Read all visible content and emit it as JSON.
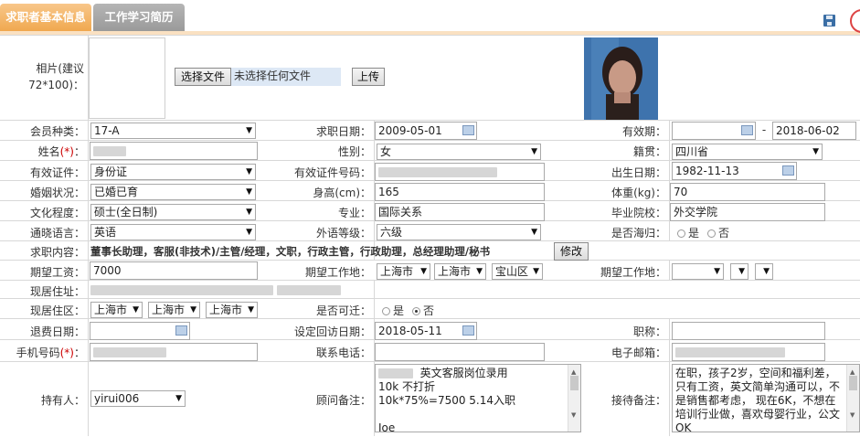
{
  "tabs": {
    "basic": "求职者基本信息",
    "resume": "工作学习简历"
  },
  "photo": {
    "label": "相片(建议72*100)：",
    "choose_btn": "选择文件",
    "no_file": "未选择任何文件",
    "upload_btn": "上传"
  },
  "fields": {
    "member_type_label": "会员种类：",
    "member_type_value": "17-A",
    "apply_date_label": "求职日期：",
    "apply_date_value": "2009-05-01",
    "valid_label": "有效期：",
    "valid_end": "2018-06-02",
    "valid_sep": "-",
    "name_label": "姓名",
    "name_req": "(*)",
    "name_colon": "：",
    "gender_label": "性别：",
    "gender_value": "女",
    "native_label": "籍贯：",
    "native_value": "四川省",
    "idtype_label": "有效证件：",
    "idtype_value": "身份证",
    "idno_label": "有效证件号码：",
    "birth_label": "出生日期：",
    "birth_value": "1982-11-13",
    "marital_label": "婚姻状况：",
    "marital_value": "已婚已育",
    "height_label": "身高(cm)：",
    "height_value": "165",
    "weight_label": "体重(kg)：",
    "weight_value": "70",
    "edu_label": "文化程度：",
    "edu_value": "硕士(全日制)",
    "major_label": "专业：",
    "major_value": "国际关系",
    "school_label": "毕业院校：",
    "school_value": "外交学院",
    "lang_label": "通晓语言：",
    "lang_value": "英语",
    "langlevel_label": "外语等级：",
    "langlevel_value": "六级",
    "overseas_label": "是否海归：",
    "yes": "是",
    "no": "否",
    "job_label": "求职内容：",
    "job_value": "董事长助理，客服(非技术)/主管/经理，文职，行政主管，行政助理，总经理助理/秘书",
    "modify_btn": "修改",
    "salary_label": "期望工资：",
    "salary_value": "7000",
    "workplace_label": "期望工作地：",
    "wp1": "上海市",
    "wp2": "上海市",
    "wp3": "宝山区",
    "workplace2_label": "期望工作地：",
    "address_label": "现居住址：",
    "area_label": "现居住区：",
    "area1": "上海市",
    "area2": "上海市",
    "area3": "上海市",
    "relocate_label": "是否可迁：",
    "refund_label": "退费日期：",
    "revisit_label": "设定回访日期：",
    "revisit_value": "2018-05-11",
    "title_label": "职称：",
    "mobile_label": "手机号码",
    "mobile_req": "(*)",
    "mobile_colon": "：",
    "phone_label": "联系电话：",
    "email_label": "电子邮箱：",
    "holder_label": "持有人：",
    "holder_value": "yirui006",
    "advisor_label": "顾问备注：",
    "advisor_l1": "英文客服岗位录用",
    "advisor_l2": "10k 不打折",
    "advisor_l3": "10k*75%=7500 5.14入职",
    "advisor_l4": "",
    "advisor_l5": "Joe",
    "reception_label": "接待备注：",
    "reception_text": "在职，孩子2岁，空间和福利差，只有工资，英文简单沟通可以，不是销售都考虑，   现在6K，不想在培训行业做，喜欢母婴行业，公文OK"
  }
}
